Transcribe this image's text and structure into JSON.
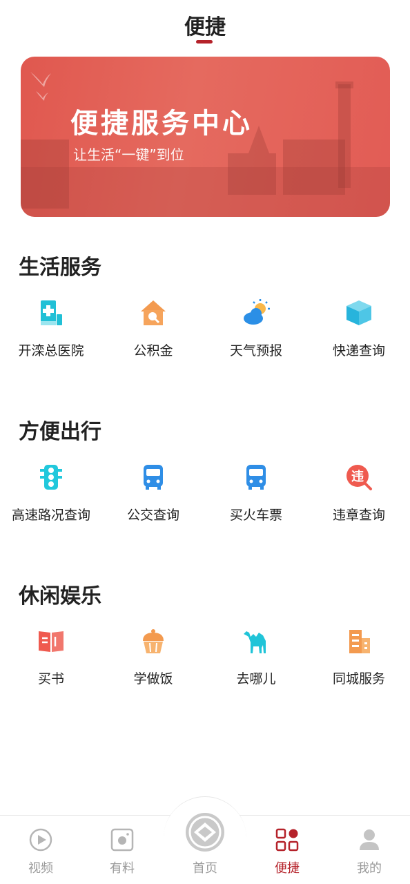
{
  "header": {
    "title": "便捷"
  },
  "banner": {
    "title": "便捷服务中心",
    "subtitle": "让生活“一键”到位"
  },
  "sections": [
    {
      "title": "生活服务",
      "items": [
        {
          "label": "开滦总医院",
          "icon": "hospital-icon"
        },
        {
          "label": "公积金",
          "icon": "housing-fund-icon"
        },
        {
          "label": "天气预报",
          "icon": "weather-icon"
        },
        {
          "label": "快递查询",
          "icon": "package-icon"
        }
      ]
    },
    {
      "title": "方便出行",
      "items": [
        {
          "label": "高速路况查询",
          "icon": "traffic-light-icon"
        },
        {
          "label": "公交查询",
          "icon": "bus-icon"
        },
        {
          "label": "买火车票",
          "icon": "train-icon"
        },
        {
          "label": "违章查询",
          "icon": "violation-search-icon",
          "glyph": "违"
        }
      ]
    },
    {
      "title": "休闲娱乐",
      "items": [
        {
          "label": "买书",
          "icon": "book-icon"
        },
        {
          "label": "学做饭",
          "icon": "cupcake-icon"
        },
        {
          "label": "去哪儿",
          "icon": "camel-icon"
        },
        {
          "label": "同城服务",
          "icon": "city-building-icon"
        }
      ]
    }
  ],
  "tabbar": {
    "items": [
      {
        "label": "视频",
        "icon": "video-play-icon"
      },
      {
        "label": "有料",
        "icon": "camera-icon"
      },
      {
        "label": "首页",
        "icon": "home-logo-icon"
      },
      {
        "label": "便捷",
        "icon": "apps-grid-icon",
        "active": true
      },
      {
        "label": "我的",
        "icon": "user-icon"
      }
    ]
  },
  "colors": {
    "accent": "#b5222a",
    "banner": "#e25c55",
    "inactive": "#9a9a9a"
  }
}
